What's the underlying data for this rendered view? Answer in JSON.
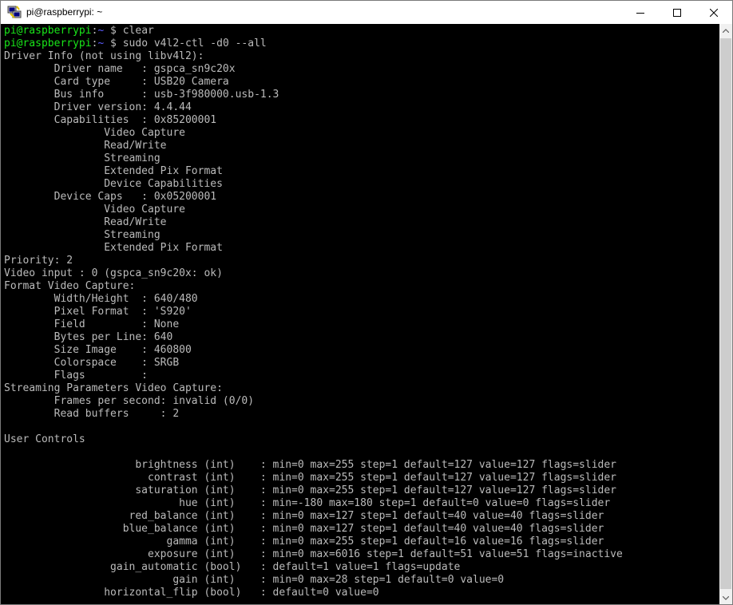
{
  "window": {
    "title": "pi@raspberrypi: ~",
    "icon": "putty-icon",
    "controls": {
      "minimize": "minimize-icon",
      "maximize": "maximize-icon",
      "close": "close-icon"
    }
  },
  "colors": {
    "background": "#000000",
    "text": "#bbbbbb",
    "prompt_user": "#19e619",
    "prompt_path": "#5c5cff"
  },
  "terminal": {
    "prompt": {
      "user_host": "pi@raspberrypi",
      "separator": ":",
      "path": "~",
      "symbol": " $ "
    },
    "commands": [
      "clear",
      "sudo v4l2-ctl -d0 --all"
    ],
    "output_lines": [
      "Driver Info (not using libv4l2):",
      "        Driver name   : gspca_sn9c20x",
      "        Card type     : USB20 Camera",
      "        Bus info      : usb-3f980000.usb-1.3",
      "        Driver version: 4.4.44",
      "        Capabilities  : 0x85200001",
      "                Video Capture",
      "                Read/Write",
      "                Streaming",
      "                Extended Pix Format",
      "                Device Capabilities",
      "        Device Caps   : 0x05200001",
      "                Video Capture",
      "                Read/Write",
      "                Streaming",
      "                Extended Pix Format",
      "Priority: 2",
      "Video input : 0 (gspca_sn9c20x: ok)",
      "Format Video Capture:",
      "        Width/Height  : 640/480",
      "        Pixel Format  : 'S920'",
      "        Field         : None",
      "        Bytes per Line: 640",
      "        Size Image    : 460800",
      "        Colorspace    : SRGB",
      "        Flags         :",
      "Streaming Parameters Video Capture:",
      "        Frames per second: invalid (0/0)",
      "        Read buffers     : 2",
      "",
      "User Controls",
      "",
      "                     brightness (int)    : min=0 max=255 step=1 default=127 value=127 flags=slider",
      "                       contrast (int)    : min=0 max=255 step=1 default=127 value=127 flags=slider",
      "                     saturation (int)    : min=0 max=255 step=1 default=127 value=127 flags=slider",
      "                            hue (int)    : min=-180 max=180 step=1 default=0 value=0 flags=slider",
      "                    red_balance (int)    : min=0 max=127 step=1 default=40 value=40 flags=slider",
      "                   blue_balance (int)    : min=0 max=127 step=1 default=40 value=40 flags=slider",
      "                          gamma (int)    : min=0 max=255 step=1 default=16 value=16 flags=slider",
      "                       exposure (int)    : min=0 max=6016 step=1 default=51 value=51 flags=inactive",
      "                 gain_automatic (bool)   : default=1 value=1 flags=update",
      "                           gain (int)    : min=0 max=28 step=1 default=0 value=0",
      "                horizontal_flip (bool)   : default=0 value=0"
    ]
  },
  "scrollbar": {
    "up_icon": "scroll-up-arrow-icon",
    "down_icon": "scroll-down-arrow-icon",
    "thumb_fraction": 0.95
  }
}
